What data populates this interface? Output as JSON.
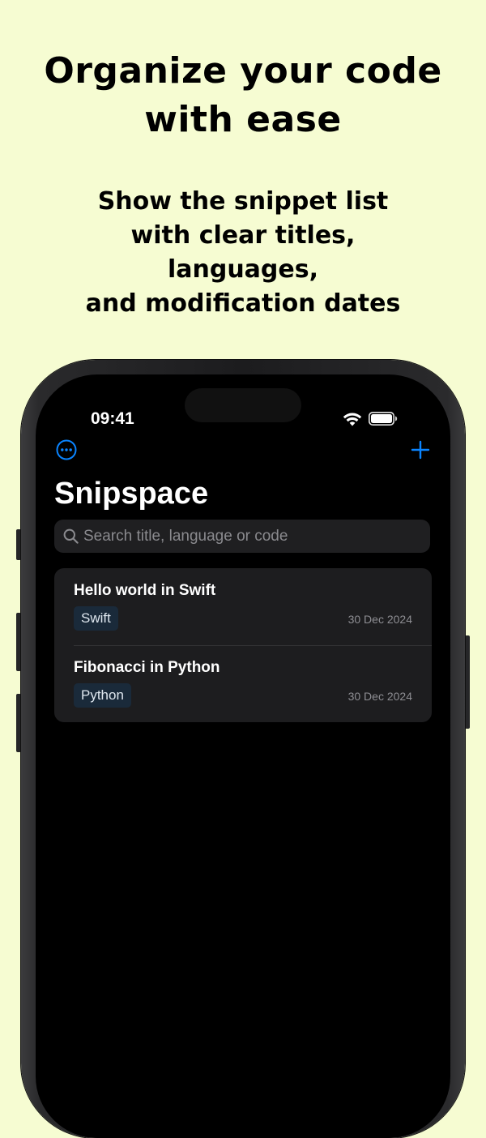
{
  "promo": {
    "headline_lines": [
      "Organize your code",
      "with ease"
    ],
    "subhead_lines": [
      "Show the snippet list",
      "with clear titles,",
      "languages,",
      "and modification dates"
    ]
  },
  "status_bar": {
    "time": "09:41",
    "icons": [
      "wifi-icon",
      "battery-icon"
    ]
  },
  "nav": {
    "left_icon": "ellipsis-circle-icon",
    "right_icon": "plus-icon",
    "accent_color": "#0a84ff"
  },
  "page": {
    "title": "Snipspace"
  },
  "search": {
    "placeholder": "Search title, language or code",
    "value": ""
  },
  "snippets": [
    {
      "title": "Hello world in Swift",
      "language": "Swift",
      "date": "30 Dec 2024"
    },
    {
      "title": "Fibonacci in Python",
      "language": "Python",
      "date": "30 Dec 2024"
    }
  ],
  "colors": {
    "page_background": "#f6fcd2",
    "screen_background": "#000000",
    "card_background": "#1d1d1f"
  }
}
